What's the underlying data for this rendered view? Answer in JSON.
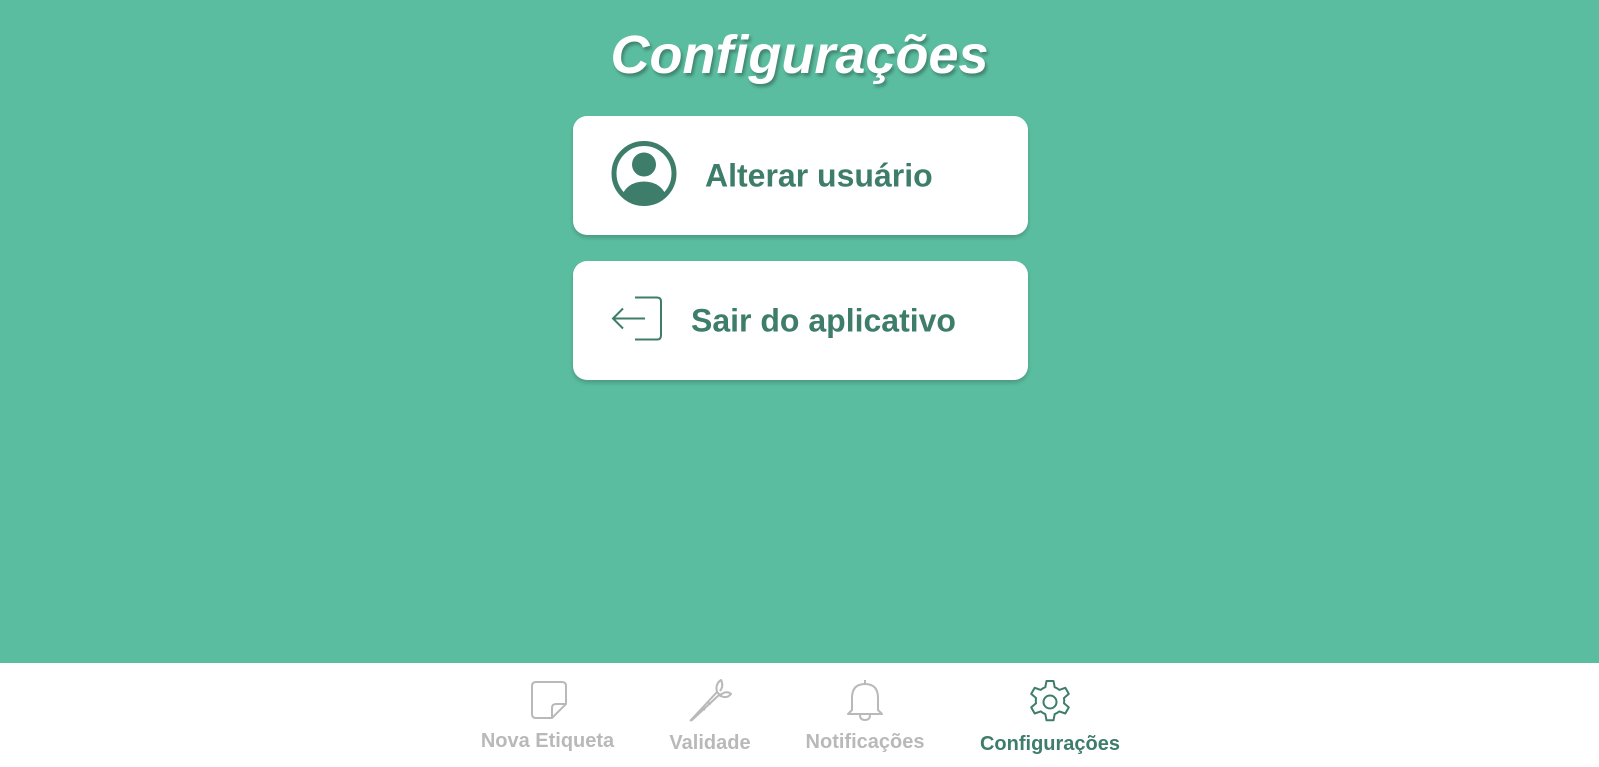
{
  "page": {
    "title": "Configurações",
    "background_color": "#5bbd9f",
    "accent_color": "#3d7d6a"
  },
  "options": [
    {
      "label": "Alterar usuário",
      "icon": "user-circle-icon"
    },
    {
      "label": "Sair do aplicativo",
      "icon": "logout-icon"
    }
  ],
  "bottom_nav": {
    "items": [
      {
        "label": "Nova Etiqueta",
        "icon": "sticky-note-icon",
        "active": false
      },
      {
        "label": "Validade",
        "icon": "carrot-icon",
        "active": false
      },
      {
        "label": "Notificações",
        "icon": "bell-icon",
        "active": false
      },
      {
        "label": "Configurações",
        "icon": "gear-icon",
        "active": true
      }
    ],
    "inactive_color": "#b9b9b9"
  }
}
